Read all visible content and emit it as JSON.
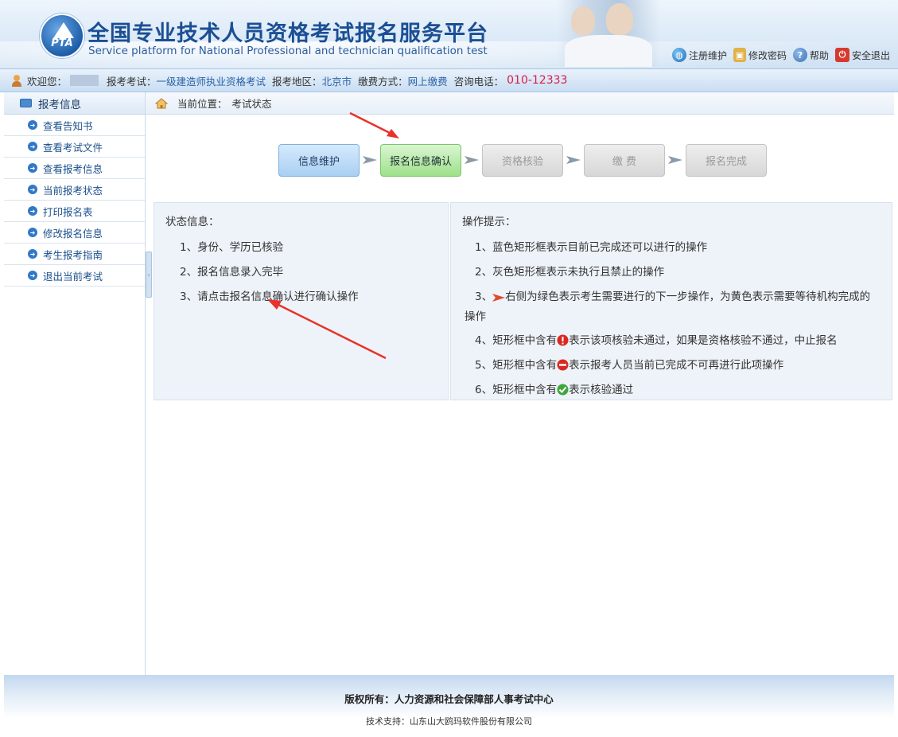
{
  "header": {
    "title": "全国专业技术人员资格考试报名服务平台",
    "subtitle": "Service platform for National Professional and technician qualification test",
    "logo_text": "PTA",
    "links": [
      {
        "label": "注册维护",
        "icon": "globe-icon",
        "color": "#2e86d1"
      },
      {
        "label": "修改密码",
        "icon": "lock-icon",
        "color": "#d19a2e"
      },
      {
        "label": "帮助",
        "icon": "help-icon",
        "color": "#3a7fcc"
      },
      {
        "label": "安全退出",
        "icon": "power-icon",
        "color": "#d43a2f"
      }
    ]
  },
  "infobar": {
    "welcome_label": "欢迎您：",
    "exam_label": "报考考试：",
    "exam_value": "一级建造师执业资格考试",
    "region_label": "报考地区：",
    "region_value": "北京市",
    "payment_label": "缴费方式：",
    "payment_value": "网上缴费",
    "phone_label": "咨询电话：",
    "phone_value": "010-12333"
  },
  "sidebar": {
    "title": "报考信息",
    "items": [
      {
        "label": "查看告知书"
      },
      {
        "label": "查看考试文件"
      },
      {
        "label": "查看报考信息"
      },
      {
        "label": "当前报考状态"
      },
      {
        "label": "打印报名表"
      },
      {
        "label": "修改报名信息"
      },
      {
        "label": "考生报考指南"
      },
      {
        "label": "退出当前考试"
      }
    ]
  },
  "breadcrumb": {
    "label": "当前位置：",
    "current": "考试状态"
  },
  "steps": [
    {
      "label": "信息维护",
      "state": "done"
    },
    {
      "label": "报名信息确认",
      "state": "current"
    },
    {
      "label": "资格核验",
      "state": "pending"
    },
    {
      "label": "缴 费",
      "state": "pending"
    },
    {
      "label": "报名完成",
      "state": "pending"
    }
  ],
  "status_panel": {
    "title": "状态信息：",
    "lines": [
      "1、身份、学历已核验",
      "2、报名信息录入完毕",
      "3、请点击报名信息确认进行确认操作"
    ]
  },
  "tips_panel": {
    "title": "操作提示：",
    "line1": "1、蓝色矩形框表示目前已完成还可以进行的操作",
    "line2": "2、灰色矩形框表示未执行且禁止的操作",
    "line3_prefix": "3、",
    "line3_text": "右侧为绿色表示考生需要进行的下一步操作，为黄色表示需要等待机构完成的",
    "line3_cont": "操作",
    "line4_prefix": "4、矩形框中含有",
    "line4_text": "表示该项核验未通过，如果是资格核验不通过，中止报名",
    "line5_prefix": "5、矩形框中含有",
    "line5_text": "表示报考人员当前已完成不可再进行此项操作",
    "line6_prefix": "6、矩形框中含有",
    "line6_text": "表示核验通过"
  },
  "footer": {
    "copyright": "版权所有：人力资源和社会保障部人事考试中心",
    "tech": "技术支持：山东山大鸥玛软件股份有限公司"
  },
  "colors": {
    "accent": "#1b4f94",
    "phone": "#d8204a",
    "step_done": "#a9cff2",
    "step_current": "#9ee08a",
    "step_pending": "#d7d7d7",
    "annotation_arrow": "#e8322b"
  }
}
